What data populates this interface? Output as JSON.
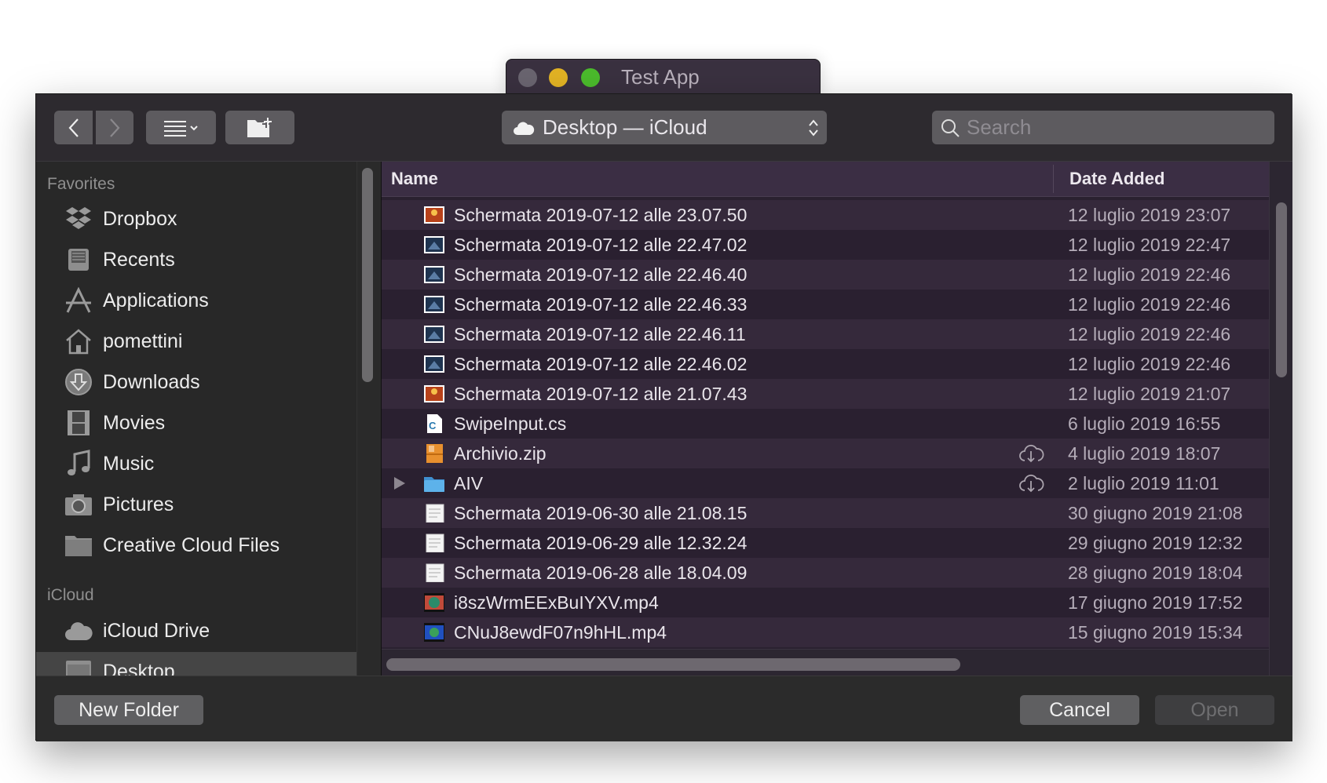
{
  "window": {
    "title": "Test App",
    "traffic_lights": {
      "close": "#6a6570",
      "minimize": "#e2b324",
      "zoom": "#4bbb2c"
    }
  },
  "toolbar": {
    "back_icon": "chevron-left-icon",
    "forward_icon": "chevron-right-icon",
    "view_icon": "list-view-icon",
    "new_folder_icon": "folder-plus-icon",
    "path_label": "Desktop — iCloud",
    "search_placeholder": "Search"
  },
  "sidebar": {
    "sections": [
      {
        "title": "Favorites",
        "items": [
          {
            "label": "Dropbox",
            "icon": "dropbox-icon"
          },
          {
            "label": "Recents",
            "icon": "recents-icon"
          },
          {
            "label": "Applications",
            "icon": "applications-icon"
          },
          {
            "label": "pomettini",
            "icon": "home-icon"
          },
          {
            "label": "Downloads",
            "icon": "downloads-icon"
          },
          {
            "label": "Movies",
            "icon": "film-icon"
          },
          {
            "label": "Music",
            "icon": "music-icon"
          },
          {
            "label": "Pictures",
            "icon": "camera-icon"
          },
          {
            "label": "Creative Cloud Files",
            "icon": "folder-icon"
          }
        ]
      },
      {
        "title": "iCloud",
        "items": [
          {
            "label": "iCloud Drive",
            "icon": "cloud-icon"
          },
          {
            "label": "Desktop",
            "icon": "desktop-icon",
            "selected": true
          }
        ]
      }
    ]
  },
  "list": {
    "columns": [
      "Name",
      "Date Added"
    ],
    "rows": [
      {
        "name": "Schermata 2019-07-12 alle 23.07.50",
        "date": "12 luglio 2019 23:07",
        "type": "image-orange"
      },
      {
        "name": "Schermata 2019-07-12 alle 22.47.02",
        "date": "12 luglio 2019 22:47",
        "type": "image-blue"
      },
      {
        "name": "Schermata 2019-07-12 alle 22.46.40",
        "date": "12 luglio 2019 22:46",
        "type": "image-blue"
      },
      {
        "name": "Schermata 2019-07-12 alle 22.46.33",
        "date": "12 luglio 2019 22:46",
        "type": "image-blue"
      },
      {
        "name": "Schermata 2019-07-12 alle 22.46.11",
        "date": "12 luglio 2019 22:46",
        "type": "image-blue"
      },
      {
        "name": "Schermata 2019-07-12 alle 22.46.02",
        "date": "12 luglio 2019 22:46",
        "type": "image-blue"
      },
      {
        "name": "Schermata 2019-07-12 alle 21.07.43",
        "date": "12 luglio 2019 21:07",
        "type": "image-orange"
      },
      {
        "name": "SwipeInput.cs",
        "date": "6 luglio 2019 16:55",
        "type": "csharp"
      },
      {
        "name": "Archivio.zip",
        "date": "4 luglio 2019 18:07",
        "type": "zip",
        "cloud": true
      },
      {
        "name": "AIV",
        "date": "2 luglio 2019 11:01",
        "type": "folder",
        "cloud": true,
        "expandable": true
      },
      {
        "name": "Schermata 2019-06-30 alle 21.08.15",
        "date": "30 giugno 2019 21:08",
        "type": "image-white"
      },
      {
        "name": "Schermata 2019-06-29 alle 12.32.24",
        "date": "29 giugno 2019 12:32",
        "type": "image-white"
      },
      {
        "name": "Schermata 2019-06-28 alle 18.04.09",
        "date": "28 giugno 2019 18:04",
        "type": "image-white"
      },
      {
        "name": "i8szWrmEExBuIYXV.mp4",
        "date": "17 giugno 2019 17:52",
        "type": "video-green"
      },
      {
        "name": "CNuJ8ewdF07n9hHL.mp4",
        "date": "15 giugno 2019 15:34",
        "type": "video-blue"
      }
    ]
  },
  "footer": {
    "new_folder": "New Folder",
    "cancel": "Cancel",
    "open": "Open"
  }
}
